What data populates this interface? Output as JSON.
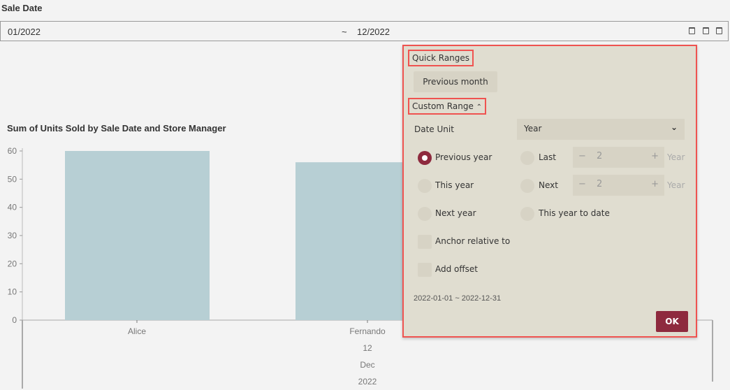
{
  "filter": {
    "label": "Sale Date",
    "from": "01/2022",
    "separator": "~",
    "to": "12/2022",
    "icons": [
      "calendar-icon",
      "calendar-icon",
      "calendar-icon"
    ]
  },
  "chart_data": {
    "type": "bar",
    "title": "Sum of Units Sold by Sale Date and Store Manager",
    "categories": [
      "Alice",
      "Fernando"
    ],
    "values": [
      60,
      56
    ],
    "group_labels": [
      "12",
      "Dec",
      "2022"
    ],
    "yticks": [
      0,
      10,
      20,
      30,
      40,
      50,
      60
    ],
    "ylim": [
      0,
      60
    ],
    "bar_color": "#b7cfd4",
    "grid": false
  },
  "popup": {
    "quick_ranges": "Quick Ranges",
    "previous_month": "Previous month",
    "custom_range": "Custom Range",
    "custom_range_icon": "chevron-up-icon",
    "date_unit_label": "Date Unit",
    "date_unit_value": "Year",
    "options": {
      "previous_year": "Previous year",
      "this_year": "This year",
      "next_year": "Next year",
      "last": "Last",
      "next": "Next",
      "this_year_to_date": "This year to date"
    },
    "selected": "Previous year",
    "last_value": "2",
    "next_value": "2",
    "unit": "Year",
    "anchor": "Anchor relative to",
    "offset": "Add offset",
    "result": "2022-01-01 ~ 2022-12-31",
    "ok": "OK",
    "accent": "#8e2a3e",
    "highlight": "#ef5350"
  }
}
